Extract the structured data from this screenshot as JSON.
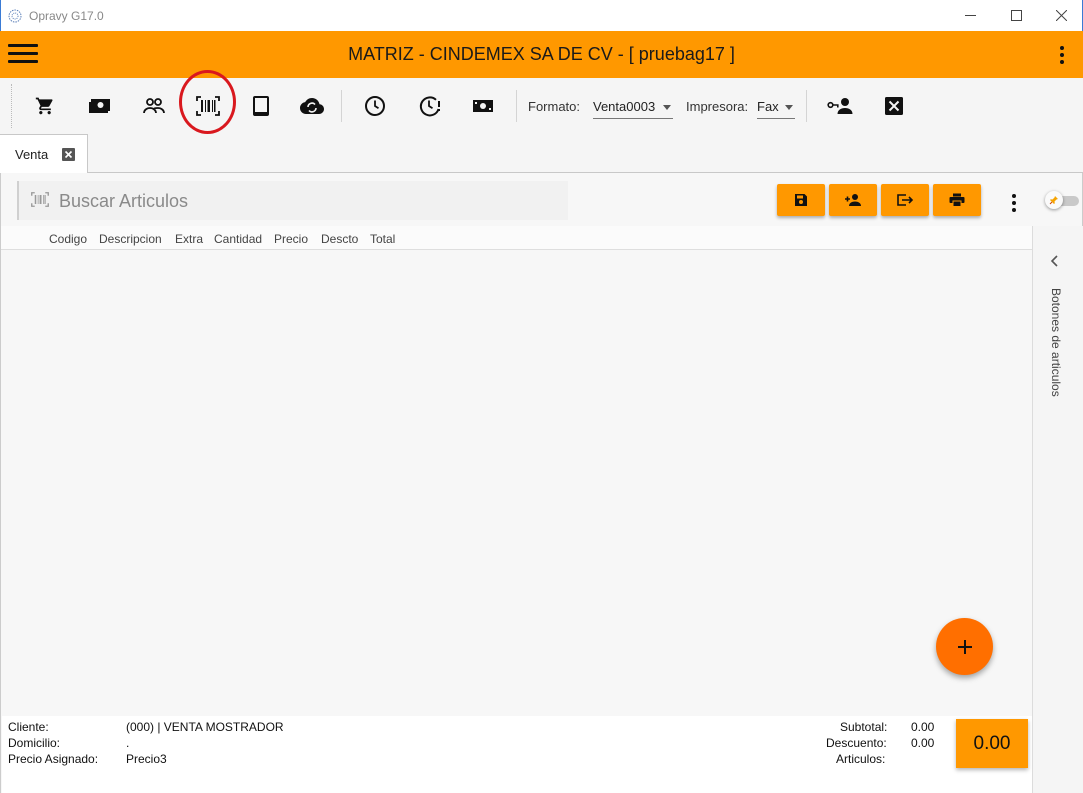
{
  "window": {
    "title": "Opravy G17.0",
    "controls": [
      "minimize-icon",
      "maximize-icon",
      "close-icon"
    ]
  },
  "header": {
    "title": "MATRIZ - CINDEMEX SA DE CV - [ pruebag17 ]",
    "accent": "#ff9800"
  },
  "toolbar": {
    "icons": [
      "cart-icon",
      "cash-icon",
      "people-icon",
      "barcode-icon",
      "tablet-icon",
      "cloud-sync-icon",
      "clock-icon",
      "clock-alert-icon",
      "money-icon",
      "user-key-icon",
      "close-box-icon"
    ],
    "formato_label": "Formato:",
    "formato_value": "Venta0003",
    "impresora_label": "Impresora:",
    "impresora_value": "Fax"
  },
  "tabs": [
    {
      "label": "Venta",
      "active": true
    }
  ],
  "search": {
    "placeholder": "Buscar Articulos"
  },
  "actions": [
    "save-icon",
    "add-person-icon",
    "exit-icon",
    "print-icon"
  ],
  "grid": {
    "columns": [
      "Codigo",
      "Descripcion",
      "Extra",
      "Cantidad",
      "Precio",
      "Descto",
      "Total"
    ],
    "rows": []
  },
  "side_panel": {
    "label": "Botones de articulos"
  },
  "footer": {
    "cliente_label": "Cliente:",
    "cliente_value": "(000) | VENTA MOSTRADOR",
    "domicilio_label": "Domicilio:",
    "domicilio_value": ".",
    "precio_label": "Precio Asignado:",
    "precio_value": "Precio3",
    "subtotal_label": "Subtotal:",
    "subtotal_value": "0.00",
    "descuento_label": "Descuento:",
    "descuento_value": "0.00",
    "articulos_label": "Articulos:",
    "articulos_value": "",
    "total": "0.00"
  },
  "colors": {
    "orange": "#ff9800",
    "fab": "#ff6f00",
    "highlight": "#d9181e"
  }
}
